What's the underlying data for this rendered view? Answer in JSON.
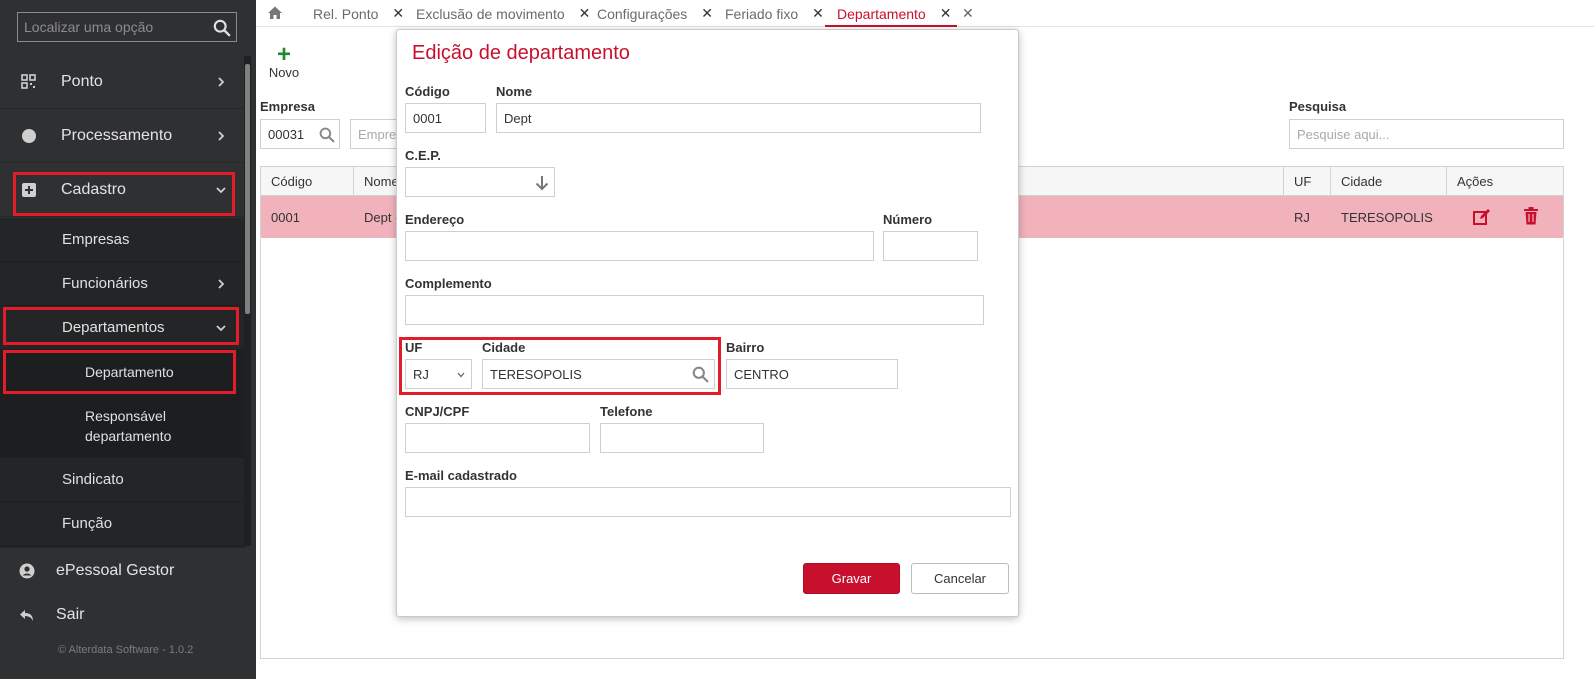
{
  "sidebar": {
    "search_placeholder": "Localizar uma opção",
    "items": [
      {
        "label": "Ponto"
      },
      {
        "label": "Processamento"
      },
      {
        "label": "Cadastro"
      }
    ],
    "cadastro_sub": {
      "empresas": "Empresas",
      "funcionarios": "Funcionários",
      "departamentos": "Departamentos",
      "departamento": "Departamento",
      "responsavel": "Responsável departamento",
      "sindicato": "Sindicato",
      "funcao": "Função"
    },
    "bottom": [
      {
        "label": "ePessoal Gestor"
      },
      {
        "label": "Sair"
      }
    ],
    "copyright": "© Alterdata Software - 1.0.2"
  },
  "tabs": [
    {
      "label": "Rel. Ponto"
    },
    {
      "label": "Exclusão de movimento"
    },
    {
      "label": "Configurações"
    },
    {
      "label": "Feriado fixo"
    },
    {
      "label": "Departamento",
      "active": true
    }
  ],
  "toolbar": {
    "novo_label": "Novo"
  },
  "filters": {
    "empresa_label": "Empresa",
    "empresa_code": "00031",
    "empresa_name_placeholder": "Empre",
    "pesquisa_label": "Pesquisa",
    "pesquisa_placeholder": "Pesquise aqui..."
  },
  "grid": {
    "headers": {
      "codigo": "Código",
      "nome": "Nome",
      "uf": "UF",
      "cidade": "Cidade",
      "acoes": "Ações"
    },
    "rows": [
      {
        "codigo": "0001",
        "nome": "Dept -",
        "uf": "RJ",
        "cidade": "TERESOPOLIS"
      }
    ]
  },
  "modal": {
    "title": "Edição de departamento",
    "fields": {
      "codigo": {
        "label": "Código",
        "value": "0001"
      },
      "nome": {
        "label": "Nome",
        "value": "Dept"
      },
      "cep": {
        "label": "C.E.P.",
        "value": ""
      },
      "endereco": {
        "label": "Endereço",
        "value": ""
      },
      "numero": {
        "label": "Número",
        "value": ""
      },
      "complemento": {
        "label": "Complemento",
        "value": ""
      },
      "uf": {
        "label": "UF",
        "value": "RJ"
      },
      "cidade": {
        "label": "Cidade",
        "value": "TERESOPOLIS"
      },
      "bairro": {
        "label": "Bairro",
        "value": "CENTRO"
      },
      "cnpj": {
        "label": "CNPJ/CPF",
        "value": ""
      },
      "telefone": {
        "label": "Telefone",
        "value": ""
      },
      "email": {
        "label": "E-mail cadastrado",
        "value": ""
      }
    },
    "save_label": "Gravar",
    "cancel_label": "Cancelar"
  },
  "colors": {
    "brand_red": "#c8102e",
    "highlight_red": "#e11d2a",
    "row_selected": "#f1b2bb",
    "sidebar_bg": "#2f3032",
    "add_green": "#1c8c2f"
  }
}
